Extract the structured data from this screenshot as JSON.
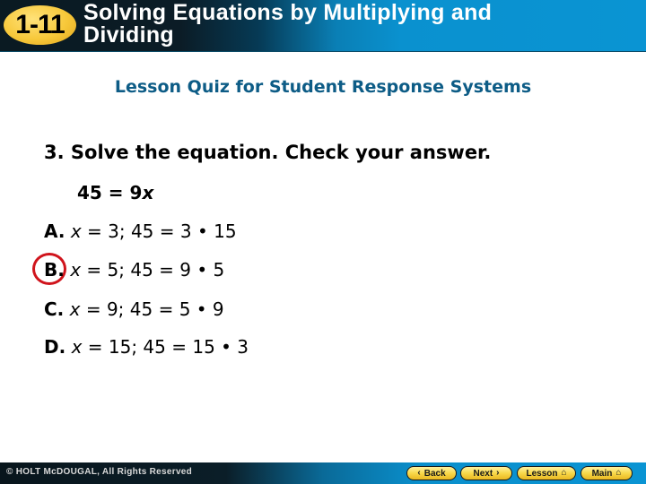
{
  "header": {
    "lesson_number": "1-11",
    "title_line1": "Solving Equations by Multiplying and",
    "title_line2": "Dividing"
  },
  "subtitle": "Lesson Quiz for Student Response Systems",
  "question": {
    "text": "3. Solve the equation. Check your answer.",
    "equation_left": "45 = 9",
    "equation_var": "x"
  },
  "choices": [
    {
      "letter": "A.",
      "var": "x",
      "rest": " = 3; 45 = 3 • 15",
      "correct": false
    },
    {
      "letter": "B.",
      "var": "x",
      "rest": " = 5; 45 = 9 • 5",
      "correct": true
    },
    {
      "letter": "C.",
      "var": "x",
      "rest": " = 9; 45 = 5 • 9",
      "correct": false
    },
    {
      "letter": "D.",
      "var": "x",
      "rest": " = 15; 45 = 15 • 3",
      "correct": false
    }
  ],
  "footer": {
    "copyright": "© HOLT McDOUGAL, All Rights Reserved",
    "nav": {
      "back_label": "Back",
      "back_icon": "‹",
      "next_label": "Next",
      "next_icon": "›",
      "lesson_label": "Lesson",
      "lesson_icon": "⌂",
      "main_label": "Main",
      "main_icon": "⌂"
    }
  },
  "colors": {
    "accent_blue": "#0a94d3",
    "subtitle_blue": "#0d5c86",
    "badge_yellow": "#f7c83a",
    "correct_circle": "#d0141c"
  }
}
